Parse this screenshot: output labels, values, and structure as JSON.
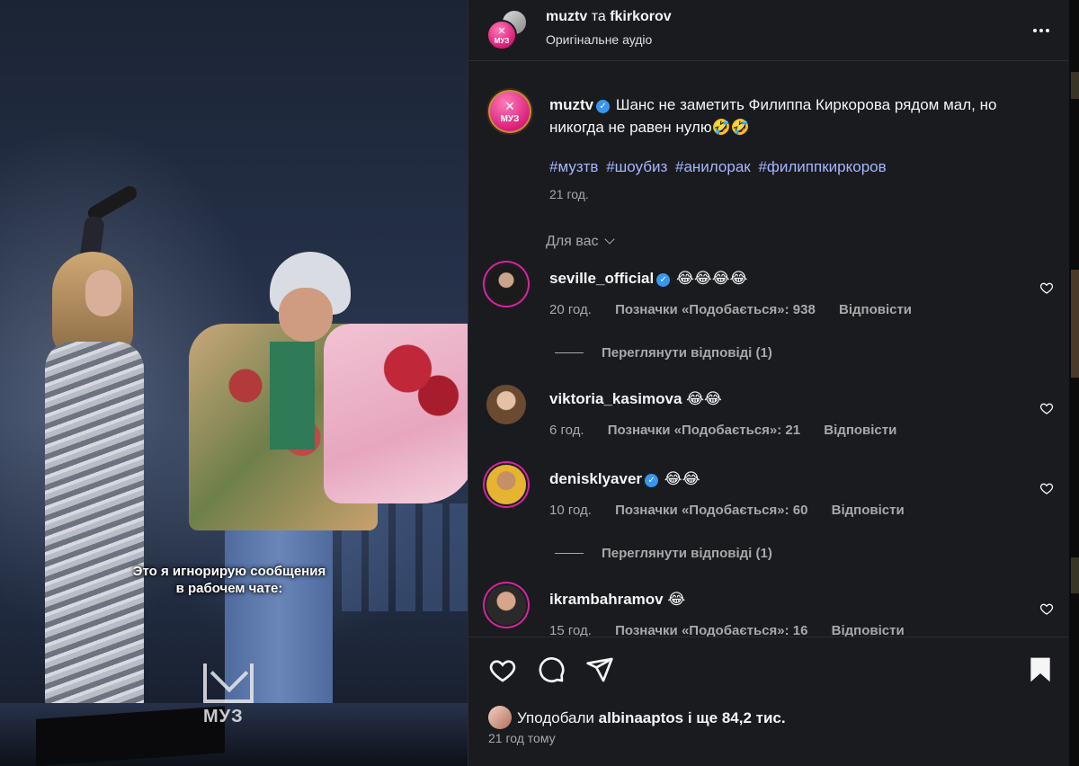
{
  "video": {
    "subtitle_line1": "Это я игнорирую сообщения",
    "subtitle_line2": "в рабочем чате:",
    "watermark": "МУЗ"
  },
  "header": {
    "user1": "muztv",
    "conjunction": "та",
    "user2": "fkirkorov",
    "audio": "Оригінальне аудіо",
    "more_icon": "more-horizontal-icon",
    "avatar_logo": "МУЗ"
  },
  "caption": {
    "user": "muztv",
    "text": "Шанс не заметить Филиппа Киркорова рядом мал, но никогда не равен нулю🤣🤣",
    "hashtags": [
      "#музтв",
      "#шоубиз",
      "#анилорак",
      "#филиппкиркоров"
    ],
    "time": "21 год."
  },
  "for_you": "Для вас",
  "comments": [
    {
      "user": "seville_official",
      "verified": true,
      "text": "😂😂😂😂",
      "time": "20 год.",
      "likes": "Позначки «Подобається»: 938",
      "reply": "Відповісти",
      "view_replies": "Переглянути відповіді (1)"
    },
    {
      "user": "viktoria_kasimova",
      "verified": false,
      "text": "😂😂",
      "time": "6 год.",
      "likes": "Позначки «Подобається»: 21",
      "reply": "Відповісти"
    },
    {
      "user": "denisklyaver",
      "verified": true,
      "text": "😂😂",
      "time": "10 год.",
      "likes": "Позначки «Подобається»: 60",
      "reply": "Відповісти",
      "view_replies": "Переглянути відповіді (1)"
    },
    {
      "user": "ikrambahramov",
      "verified": false,
      "text": "😂",
      "time": "15 год.",
      "likes": "Позначки «Подобається»: 16",
      "reply": "Відповісти"
    }
  ],
  "actions": {
    "icons": [
      "heart-icon",
      "comment-icon",
      "share-icon",
      "bookmark-icon"
    ],
    "liked_by_prefix": "Уподобали",
    "liked_by_user": "albinaaptos",
    "liked_by_suffix": "і ще 84,2 тис.",
    "post_time": "21 год тому"
  },
  "colors": {
    "panel_bg": "#1a1b1f",
    "hashtag": "#a5b6ff",
    "verified": "#3797f0",
    "muz_pink": "#d81b77"
  }
}
